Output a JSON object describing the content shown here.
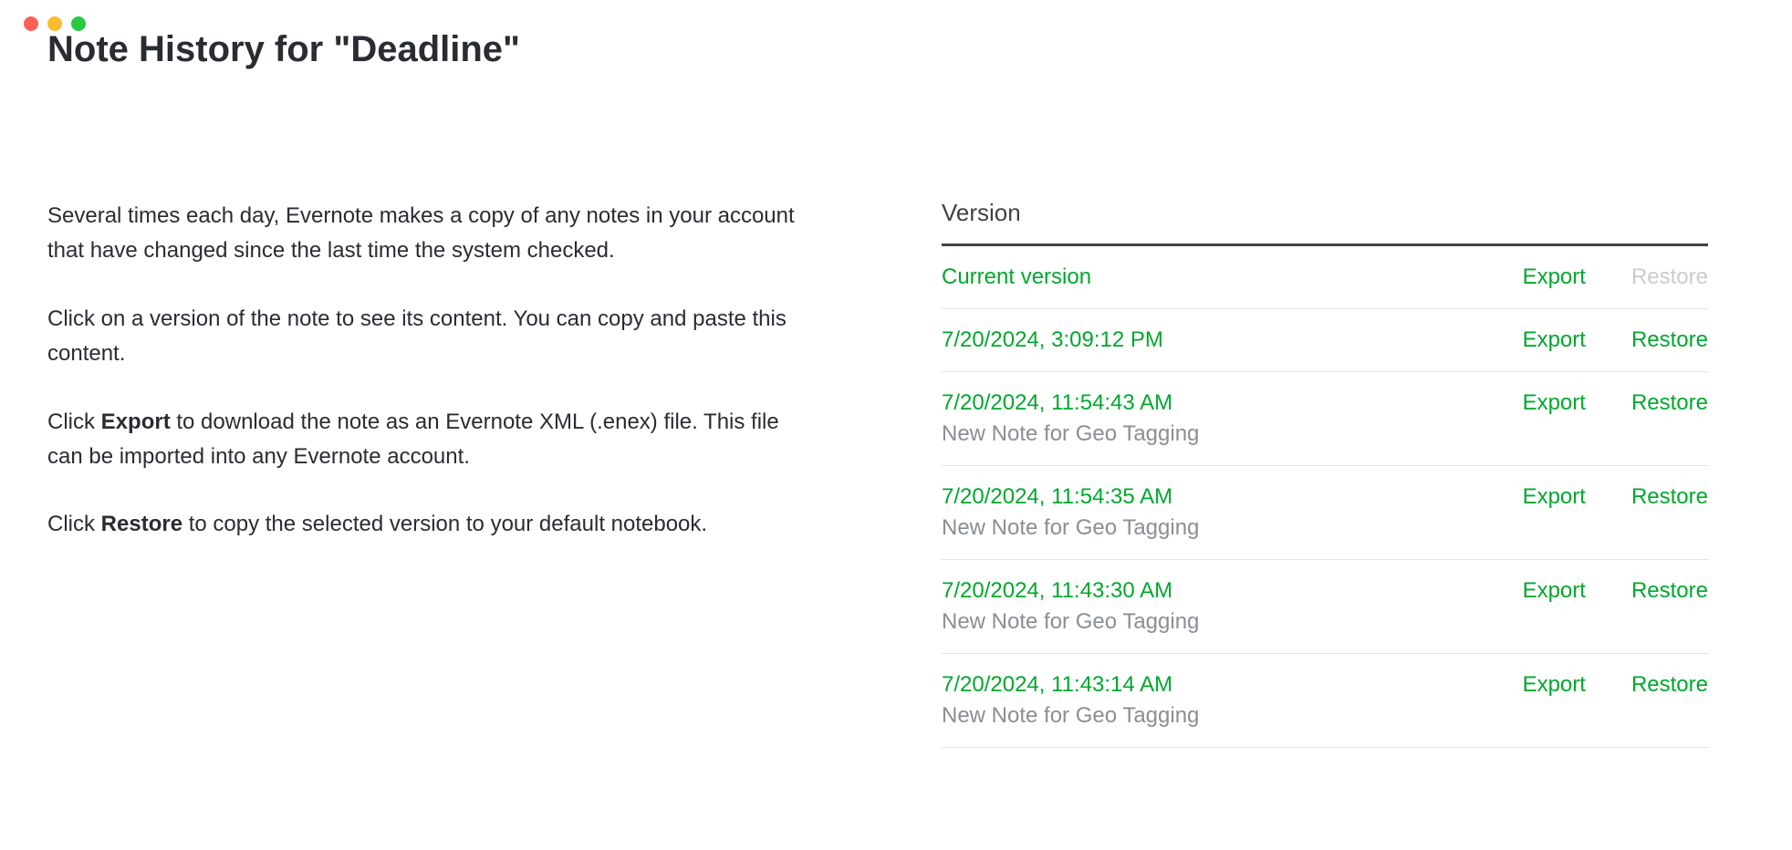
{
  "title": "Note History for \"Deadline\"",
  "info": {
    "p1": "Several times each day, Evernote makes a copy of any notes in your account that have changed since the last time the system checked.",
    "p2": "Click on a version of the note to see its content. You can copy and paste this content.",
    "p3_prefix": "Click ",
    "p3_bold": "Export",
    "p3_suffix": " to download the note as an Evernote XML (.enex) file. This file can be imported into any Evernote account.",
    "p4_prefix": "Click ",
    "p4_bold": "Restore",
    "p4_suffix": " to copy the selected version to your default notebook."
  },
  "table": {
    "heading": "Version",
    "export_label": "Export",
    "restore_label": "Restore"
  },
  "versions": [
    {
      "label": "Current version",
      "subtitle": "",
      "restore_enabled": false
    },
    {
      "label": "7/20/2024, 3:09:12 PM",
      "subtitle": "",
      "restore_enabled": true
    },
    {
      "label": "7/20/2024, 11:54:43 AM",
      "subtitle": "New Note for Geo Tagging",
      "restore_enabled": true
    },
    {
      "label": "7/20/2024, 11:54:35 AM",
      "subtitle": "New Note for Geo Tagging",
      "restore_enabled": true
    },
    {
      "label": "7/20/2024, 11:43:30 AM",
      "subtitle": "New Note for Geo Tagging",
      "restore_enabled": true
    },
    {
      "label": "7/20/2024, 11:43:14 AM",
      "subtitle": "New Note for Geo Tagging",
      "restore_enabled": true
    }
  ]
}
